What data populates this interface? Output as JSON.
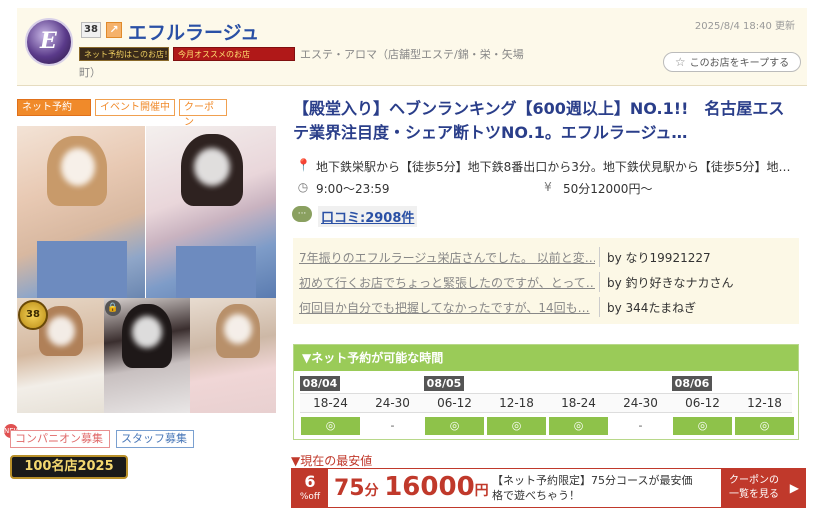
{
  "header": {
    "shop_name": "エフルラージュ",
    "rank_number": "38",
    "update_time": "2025/8/4 18:40 更新",
    "badge_net": "ネット予約はこのお店！",
    "badge_month": "今月オススメのお店",
    "category_line1": "エステ・アロマ（店舗型エステ/錦・栄・矢場",
    "category_line2": "町）",
    "keep_label": "このお店をキープする"
  },
  "tags": {
    "net": "ネット予約",
    "event": "イベント開催中",
    "coupon": "クーポン"
  },
  "photos": {
    "medal_text": "38",
    "lock_icon": "lock-icon"
  },
  "recruit": {
    "new_mark": "NEW",
    "companion": "コンパニオン募集",
    "staff": "スタッフ募集",
    "meiten": "100名店2025"
  },
  "main": {
    "headline": "【殿堂入り】ヘブンランキング【600週以上】NO.1!!　名古屋エステ業界注目度・シェア断トツNO.1。エフルラージュ…",
    "access": "地下鉄栄駅から【徒歩5分】地下鉄8番出口から3分。地下鉄伏見駅から【徒歩5分】地…",
    "hours": "9:00〜23:59",
    "price": "50分12000円〜",
    "kuchikomi": "口コミ:2908件"
  },
  "reviews": [
    {
      "text": "7年振りのエフルラージュ栄店さんでした。 以前と変…",
      "by": "by なり19921227"
    },
    {
      "text": "初めて行くお店でちょっと緊張したのですが、とって…",
      "by": "by 釣り好きなナカさん"
    },
    {
      "text": "何回目か自分でも把握してなかったですが、14回も…",
      "by": "by 344たまねぎ"
    }
  ],
  "reserve": {
    "title": "▼ネット予約が可能な時間",
    "dates": [
      "08/04",
      "08/05",
      "08/06"
    ],
    "slots": [
      "18-24",
      "24-30",
      "06-12",
      "12-18",
      "18-24",
      "24-30",
      "06-12",
      "12-18"
    ],
    "availability": [
      "◎",
      "-",
      "◎",
      "◎",
      "◎",
      "-",
      "◎",
      "◎"
    ]
  },
  "lowest": {
    "label": "▼現在の最安値",
    "off_percent": "6",
    "off_unit": "%off",
    "minutes": "75",
    "minutes_unit": "分",
    "yen": "16000",
    "yen_unit": "円",
    "note": "【ネット予約限定】75分コースが最安価格で遊べちゃう！",
    "coupon_btn_line1": "クーポンの",
    "coupon_btn_line2": "一覧を見る",
    "arrow": "▶"
  },
  "colors": {
    "accent_orange": "#f08a2a",
    "link_blue": "#2a50a5",
    "headline_blue": "#2a3e8a",
    "reserve_green": "#9acb58",
    "price_red": "#c0392b"
  }
}
